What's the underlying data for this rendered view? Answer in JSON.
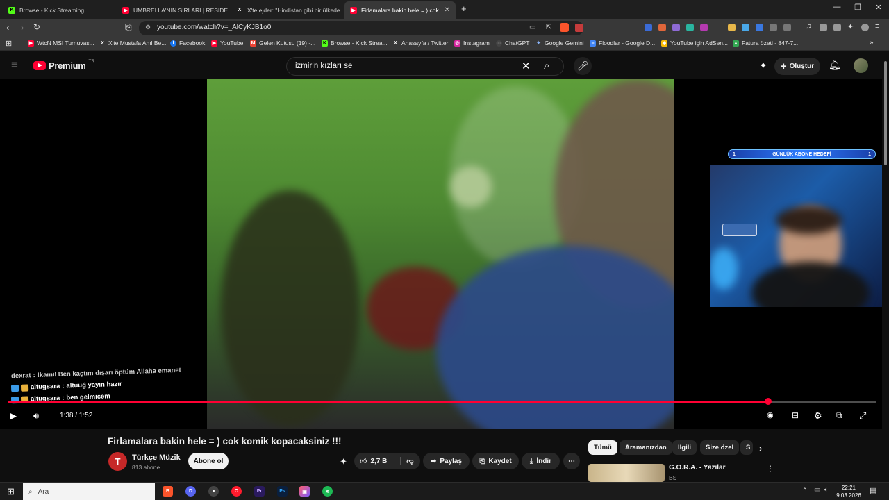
{
  "browser": {
    "tabs": [
      {
        "label": "Browse - Kick Streaming",
        "icon": "kick-icon",
        "color": "#53fc18"
      },
      {
        "label": "UMBRELLA'NIN SIRLARI | RESIDENT",
        "icon": "youtube-icon",
        "color": "#ff0033"
      },
      {
        "label": "X'te ejder: \"Hindistan gibi bir ülkede",
        "icon": "x-icon",
        "color": "#ffffff"
      },
      {
        "label": "Firlamalara bakin hele = ) cok ko",
        "icon": "youtube-icon",
        "color": "#ff0033"
      }
    ],
    "new_tab": "+",
    "url": "youtube.com/watch?v=_AlCyKJB1o0",
    "bookmarks": [
      {
        "label": "WtcN MSI Turnuvas...",
        "icon": "youtube-icon"
      },
      {
        "label": "X'te Mustafa Anıl Be...",
        "icon": "x-icon"
      },
      {
        "label": "Facebook",
        "icon": "facebook-icon"
      },
      {
        "label": "YouTube",
        "icon": "youtube-icon"
      },
      {
        "label": "Gelen Kutusu (19) -...",
        "icon": "gmail-icon"
      },
      {
        "label": "Browse - Kick Strea...",
        "icon": "kick-icon"
      },
      {
        "label": "Anasayfa / Twitter",
        "icon": "x-icon"
      },
      {
        "label": "Instagram",
        "icon": "instagram-icon"
      },
      {
        "label": "ChatGPT",
        "icon": "chatgpt-icon"
      },
      {
        "label": "Google Gemini",
        "icon": "gemini-icon"
      },
      {
        "label": "Floodlar - Google D...",
        "icon": "docs-icon"
      },
      {
        "label": "YouTube için AdSen...",
        "icon": "adsense-icon"
      },
      {
        "label": "Fatura özeti - 847-7...",
        "icon": "drive-icon"
      }
    ]
  },
  "youtube": {
    "logo": "Premium",
    "region": "TR",
    "search_query": "izmirin kızları se",
    "create_label": "Oluştur"
  },
  "video": {
    "goal_label": "GÜNLÜK ABONE HEDEFİ",
    "goal_current": "1",
    "goal_target": "1",
    "chat": [
      {
        "user": "dexrat",
        "text": "!kamil Ben kaçtım dışarı öptüm Allaha emanet"
      },
      {
        "user": "altugsara",
        "text": "altuuğ yayın hazır"
      },
      {
        "user": "altugsara",
        "text": "ben gelmicem"
      }
    ],
    "current_time": "1:38",
    "duration": "1:52",
    "time_display": "1:38 / 1:52",
    "progress": 0.875
  },
  "meta": {
    "title": "Firlamalara bakin hele = ) cok komik kopacaksiniz !!!",
    "channel": "Türkçe Müzik",
    "channel_initial": "T",
    "subscribers": "813 abone",
    "subscribe_label": "Abone ol",
    "likes": "2,7 B",
    "share_label": "Paylaş",
    "save_label": "Kaydet",
    "download_label": "İndir"
  },
  "chips": [
    "Tümü",
    "Aramanızdan",
    "İlgili",
    "Size özel",
    "S"
  ],
  "recommendation": {
    "title": "G.O.R.A. - Yazılar",
    "channel": "BS"
  },
  "taskbar": {
    "search_placeholder": "Ara",
    "time": "22:21",
    "date": "9.03.2026"
  }
}
